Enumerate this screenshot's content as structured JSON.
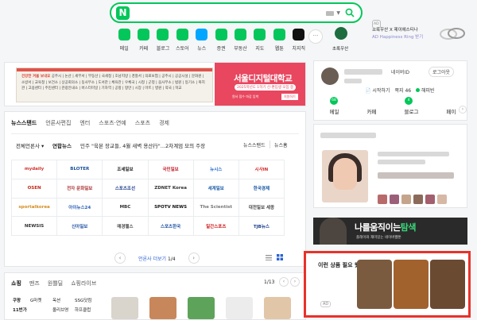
{
  "search": {
    "logo": "N",
    "placeholder": ""
  },
  "shortcuts": [
    {
      "label": "메일",
      "color": "#03c75a"
    },
    {
      "label": "카페",
      "color": "#03c75a"
    },
    {
      "label": "블로그",
      "color": "#03c75a"
    },
    {
      "label": "스토어",
      "color": "#03c75a"
    },
    {
      "label": "뉴스",
      "color": "#00a6ff"
    },
    {
      "label": "증권",
      "color": "#03c75a"
    },
    {
      "label": "부동산",
      "color": "#03c75a"
    },
    {
      "label": "지도",
      "color": "#03c75a"
    },
    {
      "label": "웹툰",
      "color": "#03c75a"
    },
    {
      "label": "치지직",
      "color": "#111111"
    }
  ],
  "more": "···",
  "partner": {
    "label": "초록우산"
  },
  "top_ad": {
    "badge": "AD",
    "line1": "초록우산 X 제이에스티나",
    "line2": "AD Happiness Ring 받기"
  },
  "banner": {
    "tag": "건강한 겨울 보내요",
    "text": "공주시 | 논산 | 세무서 | 부동산 | 국세청 | 호남지방 | 경찰서 | 의료보험 | 공주시 | 공공시설 | 문화원 | 소방서 | 교육청 | 보건소 | 상공회의소 | 동사무소 | 도서관 | 체육관 | 우체국 | 시청 | 군청 | 읍사무소 | 법원 | 등기소 | 복지관 | 고용센터 | 주민센터 | 관광안내소 | 버스터미널 | 기차역 | 공항 | 항만 | 시장 | 마트 | 병원 | 약국 | 학교",
    "right_title": "서울디지털대학교",
    "right_sub": "2025학년도 1학기 신·편입생 모집 중",
    "right_foot": "원서 접수 마감 임박",
    "right_btn": "지원하기"
  },
  "news": {
    "tabs": [
      "뉴스스탠드",
      "언론사편집",
      "엔터",
      "스포츠·연예",
      "스포츠",
      "경제"
    ],
    "category": "전체언론사",
    "press": "연합뉴스",
    "headline": "민주 \"육본 장교들, 4월 새벽 용산行\"...2차계엄 모의 주장",
    "newsstand": "뉴스스탠드",
    "newshome": "뉴스홈",
    "logos": [
      "mydaily",
      "BLOTER",
      "조세일보",
      "국민일보",
      "뉴시스",
      "시사IN",
      "OSEN",
      "전자 문화일보",
      "스포츠조선",
      "ZDNET Korea",
      "세계일보",
      "한국경제",
      "sportalkorea",
      "아이뉴스24",
      "MBC",
      "SPOTV NEWS",
      "The Scientist",
      "대전일보 세종",
      "NEWSIS",
      "신아일보",
      "매경헬스",
      "스포츠한국",
      "일간스포츠",
      "TJB뉴스"
    ],
    "pager": {
      "text": "언론사 더보기",
      "current": "1",
      "total": "/4"
    }
  },
  "shopping": {
    "tabs": [
      "쇼핑",
      "맨즈",
      "원쁠딜",
      "쇼핑라이브"
    ],
    "page": "1/13",
    "categories": [
      [
        "쿠팡",
        "G마켓",
        "옥션",
        "SSG닷컴"
      ],
      [
        "11번가",
        "",
        "올리브영",
        "하프클럽"
      ]
    ]
  },
  "login": {
    "mail": "네이버ID",
    "logout": "로그아웃",
    "stats": [
      "시작하기",
      "쪽지",
      "46",
      "해피빈"
    ],
    "badges": [
      "68",
      "4"
    ],
    "tabs": [
      "메일",
      "카페",
      "블로그",
      "페이"
    ]
  },
  "adbanner": {
    "title1": "나를",
    "title2": "움직이는",
    "title3": "탐색",
    "sub": "플레이와 재미있는 네이버웹툰"
  },
  "product_ad": {
    "title": "이런 상품 필요 했나요?",
    "badge": "AD"
  }
}
